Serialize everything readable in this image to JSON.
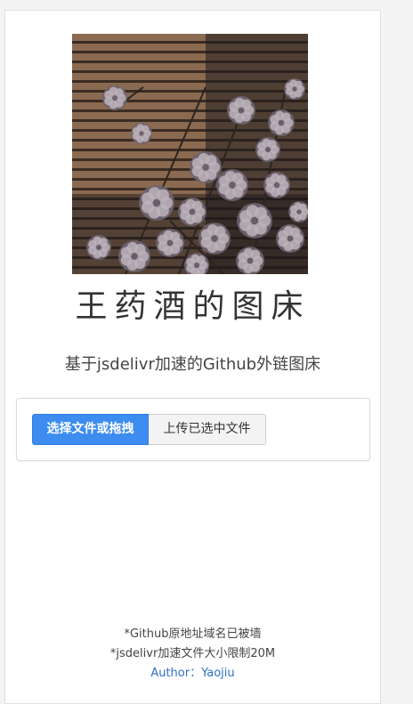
{
  "header": {
    "title": "王药酒的图床",
    "subtitle": "基于jsdelivr加速的Github外链图床",
    "image_alt": "dried flower photo"
  },
  "upload": {
    "choose_label": "选择文件或拖拽",
    "upload_label": "上传已选中文件",
    "choose_color": "#3d8cf0"
  },
  "footer": {
    "note1": "*Github原地址域名已被墙",
    "note2": "*jsdelivr加速文件大小限制20M",
    "author_prefix": "Author：",
    "author_name": "Yaojiu",
    "link_color": "#2f6fc4"
  }
}
